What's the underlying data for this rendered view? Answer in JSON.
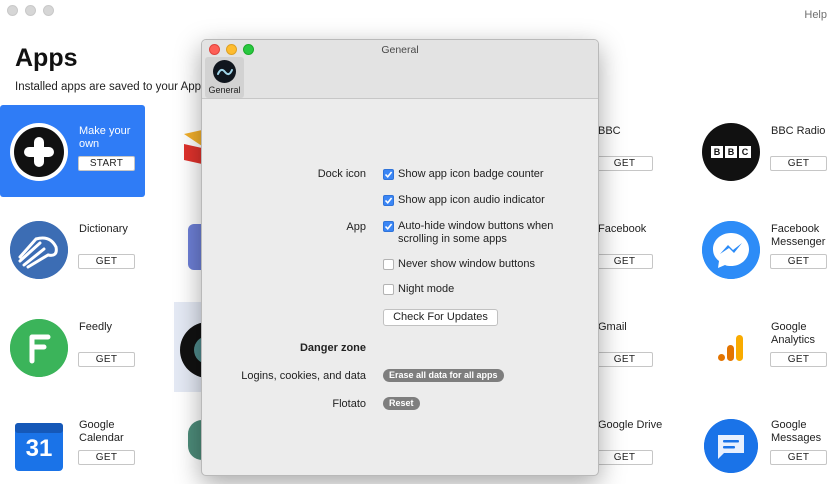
{
  "window": {
    "help_label": "Help",
    "title": "Apps",
    "subtitle": "Installed apps are saved to your App"
  },
  "apps": [
    {
      "name": "Make your own",
      "button": "START"
    },
    {
      "name": "Dictionary",
      "button": "GET"
    },
    {
      "name": "Feedly",
      "button": "GET"
    },
    {
      "name": "Google Calendar",
      "button": "GET"
    },
    {
      "name": "BBC",
      "button": "GET"
    },
    {
      "name": "Facebook",
      "button": "GET"
    },
    {
      "name": "Gmail",
      "button": "GET"
    },
    {
      "name": "Google Drive",
      "button": "GET"
    },
    {
      "name": "BBC Radio",
      "button": "GET"
    },
    {
      "name": "Facebook Messenger",
      "button": "GET"
    },
    {
      "name": "Google Analytics",
      "button": "GET"
    },
    {
      "name": "Google Messages",
      "button": "GET"
    }
  ],
  "icons": {
    "calendar_number": "31",
    "bbc_letters": [
      "B",
      "B",
      "C"
    ]
  },
  "dialog": {
    "title": "General",
    "tab_label": "General",
    "dock_icon_label": "Dock icon",
    "app_label": "App",
    "options": [
      {
        "text": "Show app icon badge counter",
        "checked": true
      },
      {
        "text": "Show app icon audio indicator",
        "checked": true
      },
      {
        "text": "Auto-hide window buttons when scrolling in some apps",
        "checked": true
      },
      {
        "text": "Never show window buttons",
        "checked": false
      },
      {
        "text": "Night mode",
        "checked": false
      }
    ],
    "check_updates_button": "Check For Updates",
    "danger_zone_label": "Danger zone",
    "logins_label": "Logins, cookies, and data",
    "erase_button": "Erase all data for all apps",
    "flotato_label": "Flotato",
    "reset_button": "Reset"
  },
  "colors": {
    "accent_blue": "#2f7cf6",
    "checkbox_blue": "#3b86f5",
    "danger_pill": "#7e7e7e"
  }
}
